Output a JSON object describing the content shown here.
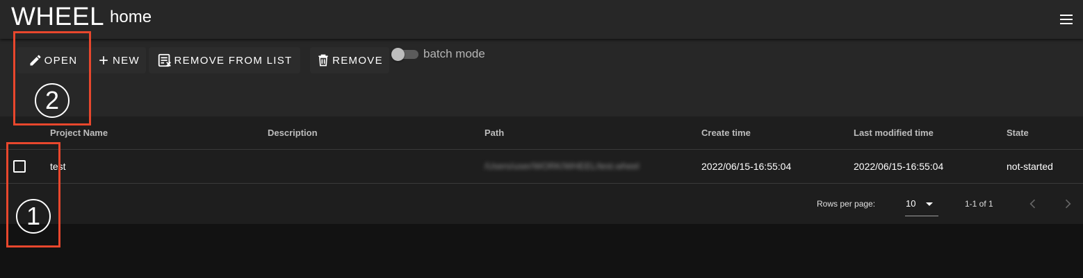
{
  "app": {
    "name": "WHEEL",
    "page_title": "home"
  },
  "toolbar": {
    "open_label": "OPEN",
    "new_label": "NEW",
    "remove_from_list_label": "REMOVE FROM LIST",
    "remove_label": "REMOVE",
    "batch_mode_label": "batch mode",
    "batch_mode_on": false
  },
  "table": {
    "columns": [
      "Project Name",
      "Description",
      "Path",
      "Create time",
      "Last modified time",
      "State"
    ],
    "rows": [
      {
        "checked": false,
        "project_name": "test",
        "description": "",
        "path": "/Users/user/WORK/WHEEL/test.wheel",
        "create_time": "2022/06/15-16:55:04",
        "last_modified_time": "2022/06/15-16:55:04",
        "state": "not-started"
      }
    ]
  },
  "pagination": {
    "rows_per_page_label": "Rows per page:",
    "rows_per_page_value": "10",
    "range_text": "1-1 of 1"
  },
  "annotations": {
    "marker_1": "1",
    "marker_2": "2"
  },
  "colors": {
    "annotation_red": "#e8472d",
    "appbar_bg": "#272727",
    "page_bg": "#121212",
    "table_bg": "#1e1e1e"
  },
  "icons": [
    "menu-icon",
    "pencil-icon",
    "plus-icon",
    "remove-from-list-icon",
    "trash-icon",
    "chevron-left-icon",
    "chevron-right-icon",
    "dropdown-arrow-icon"
  ]
}
